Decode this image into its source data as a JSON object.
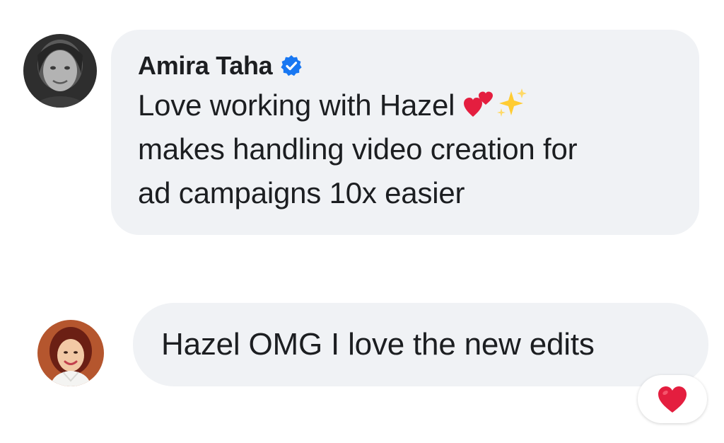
{
  "comments": [
    {
      "author": "Amira Taha",
      "verified": true,
      "text_line1": "Love working with Hazel",
      "text_rest": "makes handling video creation for\nad campaigns 10x easier",
      "inline_emojis": [
        "two-hearts",
        "sparkles"
      ],
      "avatar": "grayscale-profile-photo"
    },
    {
      "author": "",
      "text": "Hazel OMG I love the new edits",
      "avatar": "color-profile-photo",
      "reaction": "red-heart"
    }
  ],
  "colors": {
    "bubble": "#f0f2f5",
    "text": "#1c1e21",
    "verified_badge": "#1877f2",
    "heart": "#e41e3f",
    "sparkle": "#ffcc33"
  }
}
